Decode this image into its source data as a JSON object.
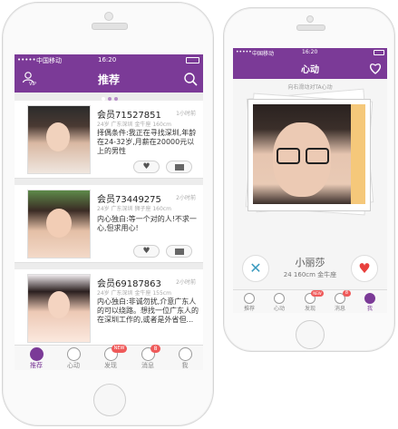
{
  "left_phone": {
    "status": {
      "carrier": "中国移动",
      "time": "16:20"
    },
    "header": {
      "title": "推荐",
      "vip_label": "VIP"
    },
    "members": [
      {
        "name": "会员71527851",
        "time": "1小时前",
        "tags": "24岁  广东深圳  金牛座  160cm",
        "desc": "择偶条件:我正在寻找深圳,年龄在24-32岁,月薪在20000元以上的男性"
      },
      {
        "name": "会员73449275",
        "time": "2小时前",
        "tags": "24岁  广东深圳  狮子座  160cm",
        "desc": "内心独白:等一个对的人!不求一心,但求用心!"
      },
      {
        "name": "会员69187863",
        "time": "2小时前",
        "tags": "24岁  广东深圳  金牛座  155cm",
        "desc": "内心独白:非诚勿扰,介意广东人的可以绕路。想找一位广东人的在深圳工作的,或者是外省但..."
      }
    ],
    "tabs": [
      {
        "label": "推荐",
        "icon": "recommend-icon",
        "active": true
      },
      {
        "label": "心动",
        "icon": "heartbeat-icon"
      },
      {
        "label": "发现",
        "icon": "discover-icon",
        "badge": "NEW"
      },
      {
        "label": "消息",
        "icon": "message-icon",
        "badge": "8"
      },
      {
        "label": "我",
        "icon": "profile-icon"
      }
    ]
  },
  "right_phone": {
    "status": {
      "carrier": "中国移动",
      "time": "16:20"
    },
    "header": {
      "title": "心动"
    },
    "hint": "向右滑动对TA心动",
    "profile": {
      "name": "小丽莎",
      "details": "24  160cm  金牛座"
    },
    "tabs": [
      {
        "label": "推荐",
        "icon": "recommend-icon"
      },
      {
        "label": "心动",
        "icon": "heartbeat-icon"
      },
      {
        "label": "发现",
        "icon": "discover-icon",
        "badge": "NEW"
      },
      {
        "label": "消息",
        "icon": "message-icon",
        "badge": "8"
      },
      {
        "label": "我",
        "icon": "profile-icon",
        "active": true
      }
    ]
  },
  "colors": {
    "accent": "#7b3a97",
    "badge": "#ef5a5a",
    "like": "#e8403d",
    "dislike": "#3b9bbf"
  }
}
